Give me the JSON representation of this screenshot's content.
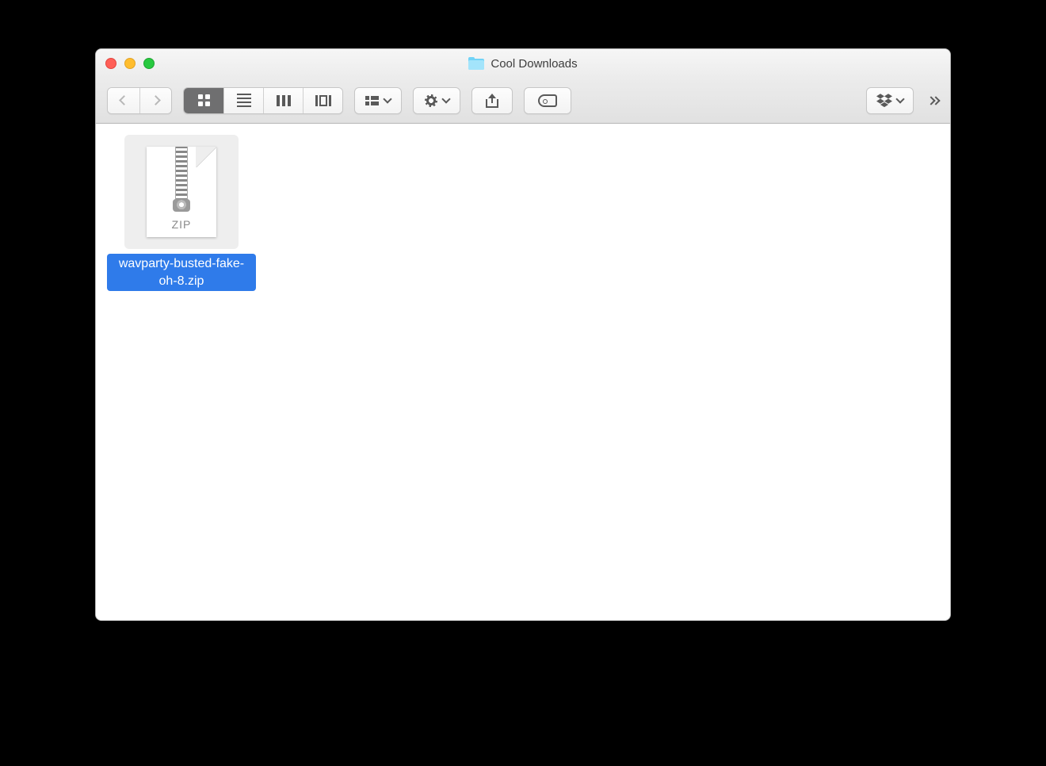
{
  "window": {
    "title": "Cool Downloads"
  },
  "files": [
    {
      "name": "wavparty-busted-fake-oh-8.zip",
      "ext": "ZIP",
      "selected": true
    }
  ]
}
